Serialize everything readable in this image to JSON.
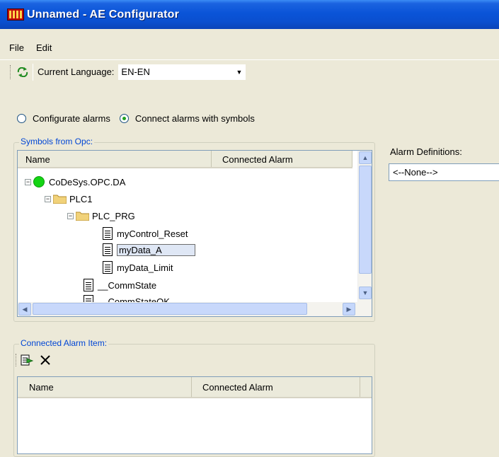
{
  "window": {
    "title": "Unnamed - AE Configurator"
  },
  "menu": {
    "items": [
      "File",
      "Edit"
    ]
  },
  "toolbar": {
    "language_label": "Current Language:",
    "language_value": "EN-EN"
  },
  "mode": {
    "option1": "Configurate alarms",
    "option2": "Connect alarms with symbols",
    "selected": "Connect alarms with symbols"
  },
  "symbols": {
    "group_title": "Symbols from Opc:",
    "columns": [
      "Name",
      "Connected Alarm"
    ],
    "tree": [
      {
        "label": "CoDeSys.OPC.DA",
        "icon": "server-icon"
      },
      {
        "label": "PLC1",
        "icon": "folder-icon"
      },
      {
        "label": "PLC_PRG",
        "icon": "folder-icon"
      },
      {
        "label": "myControl_Reset",
        "icon": "variable-icon"
      },
      {
        "label": "myData_A",
        "icon": "variable-icon",
        "selected": true
      },
      {
        "label": "myData_Limit",
        "icon": "variable-icon"
      },
      {
        "label": "__CommState",
        "icon": "variable-icon"
      },
      {
        "label": "__CommStateOK",
        "icon": "variable-icon"
      }
    ]
  },
  "alarm_definitions": {
    "label": "Alarm Definitions:",
    "value": "<--None-->"
  },
  "connected_item": {
    "group_title": "Connected Alarm Item:",
    "columns": [
      "Name",
      "Connected Alarm"
    ]
  }
}
